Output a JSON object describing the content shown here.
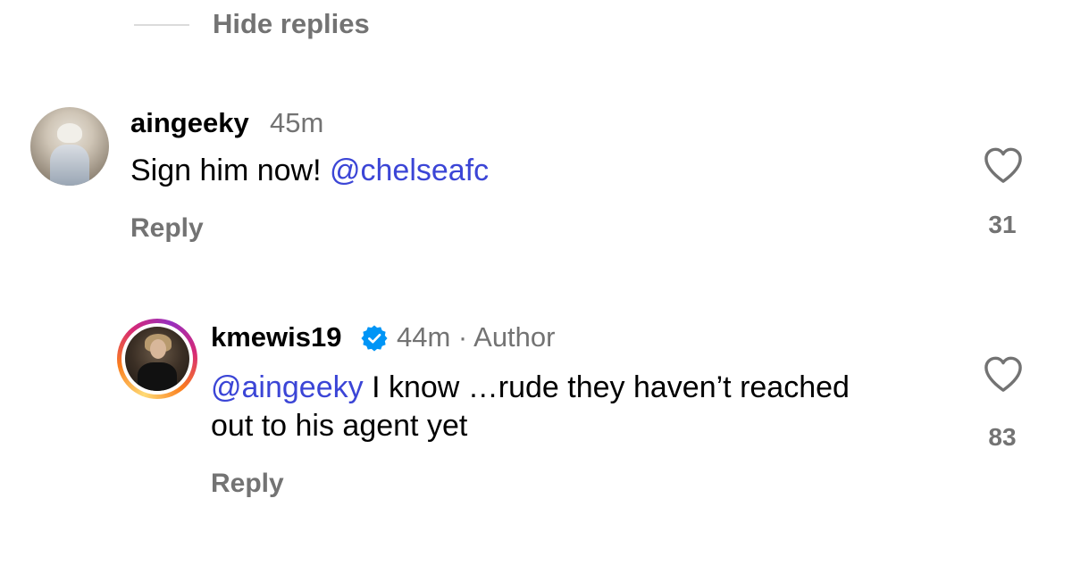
{
  "hide_replies": {
    "label": "Hide replies"
  },
  "comments": [
    {
      "username": "aingeeky",
      "time": "45m",
      "mention": "",
      "mention_text": "@chelseafc",
      "text_before": "Sign him now! ",
      "reply_label": "Reply",
      "like_count": "31",
      "avatar_icon": "user-avatar-photo"
    },
    {
      "username": "kmewis19",
      "verified": true,
      "time": "44m · Author",
      "mention_text": "@aingeeky",
      "text_after": " I know …rude they haven’t reached out to his agent yet",
      "reply_label": "Reply",
      "like_count": "83",
      "avatar_icon": "user-avatar-photo-story-ring"
    }
  ],
  "colors": {
    "mention": "#3b45d6",
    "secondary_text": "#737373",
    "verified_badge": "#0095f6"
  },
  "icons": {
    "like": "heart-outline-icon",
    "verified": "verified-badge-icon"
  }
}
